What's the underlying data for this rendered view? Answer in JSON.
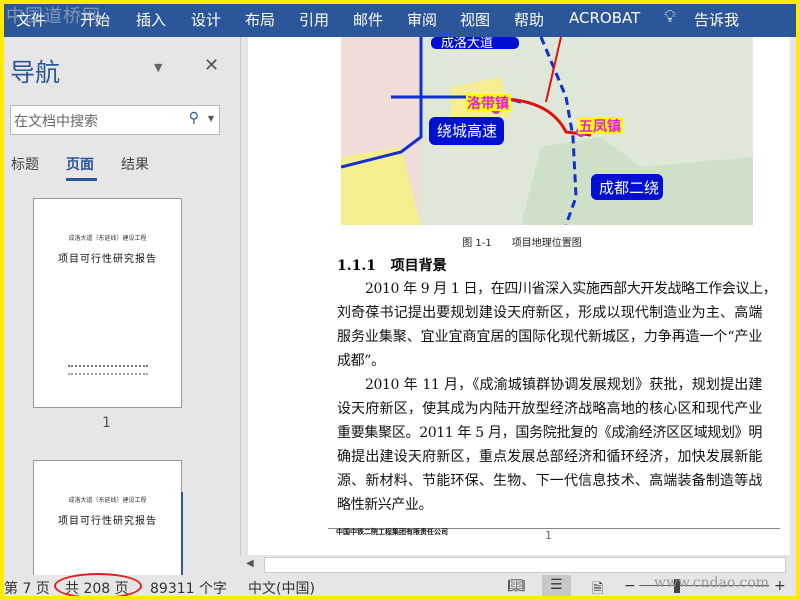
{
  "watermark": "中国道桥网",
  "ribbon": {
    "tabs": [
      "文件",
      "开始",
      "插入",
      "设计",
      "布局",
      "引用",
      "邮件",
      "审阅",
      "视图",
      "帮助",
      "ACROBAT"
    ],
    "tell_me": "告诉我"
  },
  "nav": {
    "title": "导航",
    "search_placeholder": "在文档中搜索",
    "tabs": [
      "标题",
      "页面",
      "结果"
    ],
    "active_tab": "页面",
    "thumbs": [
      {
        "subtitle": "成洛大道（东延线）建设工程",
        "title": "项目可行性研究报告",
        "page": "1"
      },
      {
        "subtitle": "成洛大道（东延线）建设工程",
        "title": "项目可行性研究报告"
      }
    ]
  },
  "document": {
    "map_labels": {
      "road1": "成洛大道",
      "road2": "绕城高速",
      "road3": "成都二绕",
      "town1": "洛带镇",
      "town2": "五凤镇"
    },
    "caption": "图 1-1　　项目地理位置图",
    "heading_num": "1.1.1",
    "heading": "项目背景",
    "lines": [
      "2010 年 9 月 1 日，在四川省深入实施西部大开发战略工作会议上，",
      "刘奇葆书记提出要规划建设天府新区，形成以现代制造业为主、高端",
      "服务业集聚、宜业宜商宜居的国际化现代新城区，力争再造一个“产业",
      "成都”。",
      "2010 年 11 月，《成渝城镇群协调发展规划》获批，规划提出建",
      "设天府新区，使其成为内陆开放型经济战略高地的核心区和现代产业",
      "重要集聚区。2011 年 5 月，国务院批复的《成渝经济区区域规划》明",
      "确提出建设天府新区，重点发展总部经济和循环经济，加快发展新能",
      "源、新材料、节能环保、生物、下一代信息技术、高端装备制造等战",
      "略性新兴产业。"
    ],
    "footer_company": "中国中铁二院工程集团有限责任公司",
    "footer_page": "1"
  },
  "status": {
    "page": "第 7 页",
    "total": "共 208 页",
    "words": "89311 个字",
    "lang": "中文(中国)",
    "zoom_minus": "−",
    "zoom_plus": "+"
  },
  "site_watermark": "www.cndao.com",
  "colors": {
    "ribbon": "#2b579a",
    "highlight_circle": "#e02020"
  }
}
